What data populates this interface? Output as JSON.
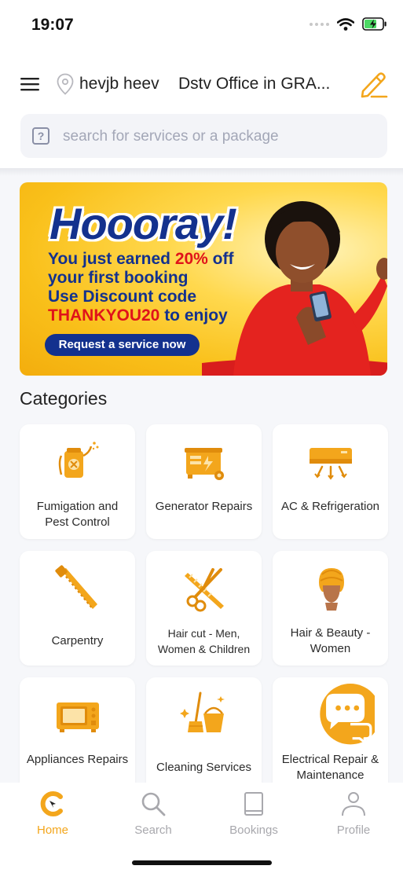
{
  "status_bar": {
    "time": "19:07"
  },
  "header": {
    "location_name": "hevjb heev",
    "location_address": "Dstv Office in GRA..."
  },
  "search": {
    "placeholder": "search for services or a package"
  },
  "banner": {
    "title": "Hoooray!",
    "line1_a": "You just earned ",
    "line1_b": "20%",
    "line1_c": " off",
    "line2": "your first booking",
    "line3": "Use Discount code",
    "line4_a": "THANKYOU20",
    "line4_b": " to enjoy",
    "cta": "Request a service now"
  },
  "categories": {
    "title": "Categories",
    "items": [
      {
        "label": "Fumigation and Pest Control",
        "icon": "fumigation-icon"
      },
      {
        "label": "Generator Repairs",
        "icon": "generator-icon"
      },
      {
        "label": "AC & Refrigeration",
        "icon": "air-conditioner-icon"
      },
      {
        "label": "Carpentry",
        "icon": "saw-icon"
      },
      {
        "label": "Hair cut - Men, Women & Children",
        "icon": "scissors-comb-icon"
      },
      {
        "label": "Hair & Beauty - Women",
        "icon": "woman-head-icon"
      },
      {
        "label": "Appliances Repairs",
        "icon": "microwave-icon"
      },
      {
        "label": "Cleaning Services",
        "icon": "cleaning-bucket-icon"
      },
      {
        "label": "Electrical Repair & Maintenance",
        "icon": "chat-bubbles-icon"
      }
    ]
  },
  "tabs": [
    {
      "label": "Home",
      "icon": "home-logo-icon",
      "active": true
    },
    {
      "label": "Search",
      "icon": "search-icon",
      "active": false
    },
    {
      "label": "Bookings",
      "icon": "book-icon",
      "active": false
    },
    {
      "label": "Profile",
      "icon": "person-icon",
      "active": false
    }
  ],
  "colors": {
    "accent": "#f3a61c",
    "banner_blue": "#13318e",
    "banner_red": "#e0131a",
    "inactive_tab": "#a8a8ad"
  }
}
